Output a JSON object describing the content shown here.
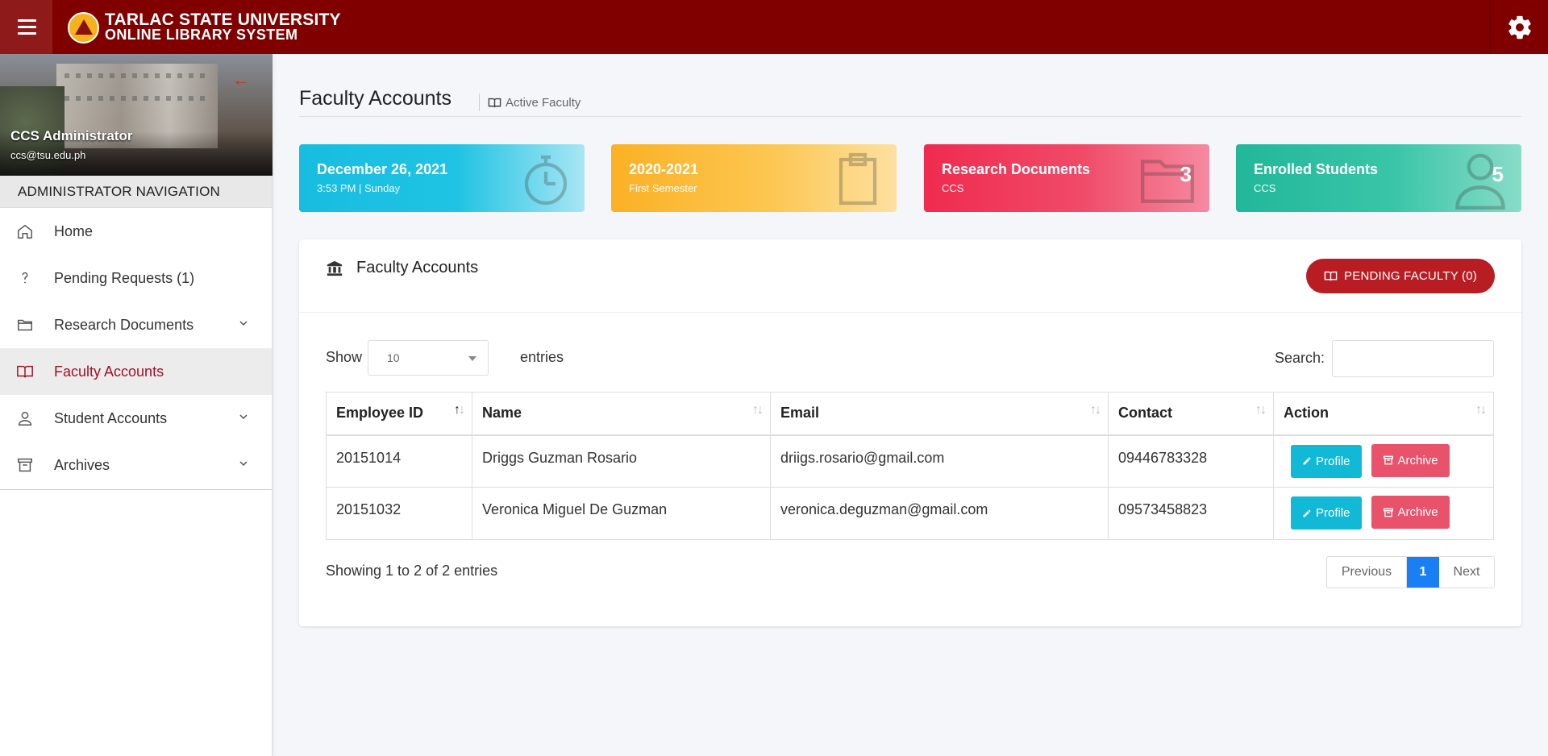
{
  "topbar": {
    "brand_line1": "TARLAC STATE UNIVERSITY",
    "brand_line2": "ONLINE LIBRARY SYSTEM"
  },
  "sidebar": {
    "user_name": "CCS Administrator",
    "user_email": "ccs@tsu.edu.ph",
    "nav_header": "ADMINISTRATOR NAVIGATION",
    "items": [
      {
        "label": "Home",
        "icon": "home-icon"
      },
      {
        "label": "Pending Requests (1)",
        "icon": "question-icon"
      },
      {
        "label": "Research Documents",
        "icon": "folder-icon"
      },
      {
        "label": "Faculty Accounts",
        "icon": "book-icon"
      },
      {
        "label": "Student Accounts",
        "icon": "user-icon"
      },
      {
        "label": "Archives",
        "icon": "archive-icon"
      }
    ]
  },
  "page": {
    "title": "Faculty Accounts",
    "subtitle": "Active Faculty"
  },
  "cards": [
    {
      "title": "December 26, 2021",
      "subtitle": "3:53 PM | Sunday",
      "icon": "stopwatch-icon"
    },
    {
      "title": "2020-2021",
      "subtitle": "First Semester",
      "icon": "clipboard-icon"
    },
    {
      "title": "Research Documents",
      "subtitle": "CCS",
      "count": "3",
      "icon": "folder-icon"
    },
    {
      "title": "Enrolled Students",
      "subtitle": "CCS",
      "count": "5",
      "icon": "user-icon"
    }
  ],
  "panel": {
    "title": "Faculty Accounts",
    "pending_button": "PENDING FACULTY (0)",
    "show_label": "Show",
    "entries_value": "10",
    "entries_label": "entries",
    "search_label": "Search:",
    "columns": [
      "Employee ID",
      "Name",
      "Email",
      "Contact",
      "Action"
    ],
    "rows": [
      {
        "id": "20151014",
        "name": "Driggs Guzman Rosario",
        "email": "driigs.rosario@gmail.com",
        "contact": "09446783328"
      },
      {
        "id": "20151032",
        "name": "Veronica Miguel De Guzman",
        "email": "veronica.deguzman@gmail.com",
        "contact": "09573458823"
      }
    ],
    "profile_label": "Profile",
    "archive_label": "Archive",
    "showing": "Showing 1 to 2 of 2 entries",
    "pager": {
      "previous": "Previous",
      "current": "1",
      "next": "Next"
    }
  },
  "colors": {
    "topbar": "#800000",
    "accent": "#a0102a",
    "pending_button": "#b81d24",
    "profile_button": "#11b9d6",
    "archive_button": "#e8536b",
    "pager_active": "#1a7ef5"
  }
}
